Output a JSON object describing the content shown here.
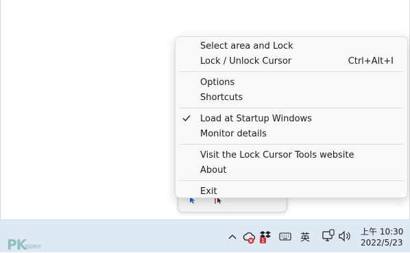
{
  "menu": {
    "items": [
      {
        "label": "Select area and Lock",
        "shortcut": "",
        "checked": false
      },
      {
        "label": "Lock / Unlock Cursor",
        "shortcut": "Ctrl+Alt+I",
        "checked": false
      },
      {
        "label": "Options",
        "shortcut": "",
        "checked": false
      },
      {
        "label": "Shortcuts",
        "shortcut": "",
        "checked": false
      },
      {
        "label": "Load at Startup Windows",
        "shortcut": "",
        "checked": true
      },
      {
        "label": "Monitor details",
        "shortcut": "",
        "checked": false
      },
      {
        "label": "Visit the Lock Cursor Tools website",
        "shortcut": "",
        "checked": false
      },
      {
        "label": "About",
        "shortcut": "",
        "checked": false
      },
      {
        "label": "Exit",
        "shortcut": "",
        "checked": false
      }
    ]
  },
  "taskbar": {
    "ime_label": "英",
    "clock_time": "上午 10:30",
    "clock_date": "2022/5/23",
    "notification_badge": "1"
  },
  "watermark": {
    "logo_text": "PK",
    "logo_sub": "電腦應用"
  },
  "colors": {
    "accent_blue": "#2b63c7",
    "badge_red": "#d13438",
    "taskbar_bg": "#dfe9f3",
    "menu_bg": "#f9f9f9"
  }
}
